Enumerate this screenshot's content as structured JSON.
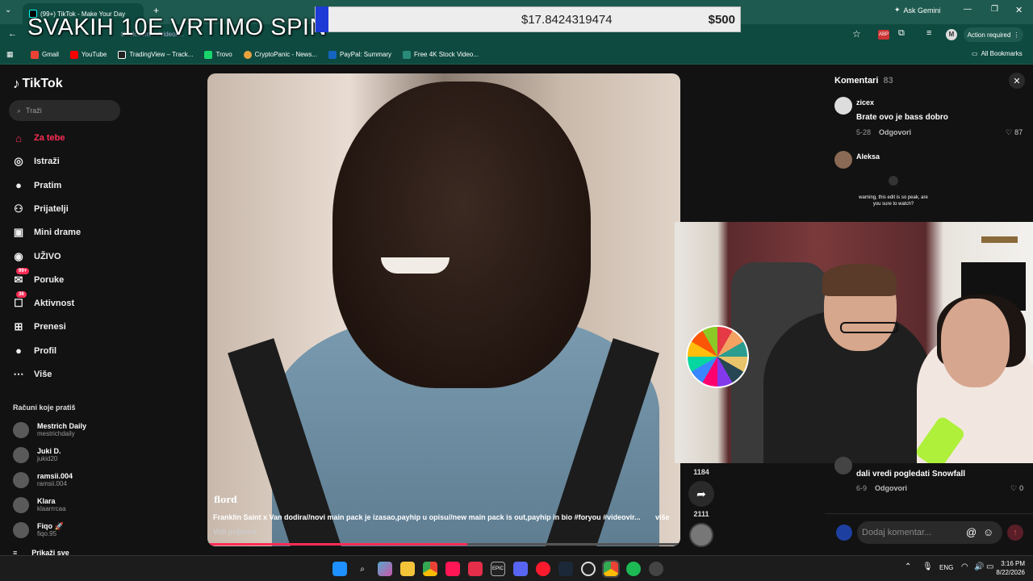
{
  "browser": {
    "tab_title": "(99+) TikTok - Make Your Day",
    "address_partial": "tiktok.com/…/video/…",
    "ask_gemini": "Ask Gemini",
    "action_required": "Action required",
    "bookmarks": [
      "Gmail",
      "YouTube",
      "TradingView – Track...",
      "Trovo",
      "CryptoPanic - News...",
      "PayPal: Summary",
      "Free 4K Stock Video..."
    ],
    "all_bookmarks": "All Bookmarks"
  },
  "overlay": {
    "title": "SVAKIH 10E VRTIMO SPIN",
    "donation_amount": "$17.8424319474",
    "donation_goal": "$500"
  },
  "tiktok": {
    "logo": "TikTok",
    "search_placeholder": "Traži",
    "nav": [
      {
        "label": "Za tebe",
        "icon": "home-icon",
        "active": true
      },
      {
        "label": "Istraži",
        "icon": "compass-icon"
      },
      {
        "label": "Pratim",
        "icon": "following-icon"
      },
      {
        "label": "Prijatelji",
        "icon": "friends-icon"
      },
      {
        "label": "Mini drame",
        "icon": "drama-icon"
      },
      {
        "label": "UŽIVO",
        "icon": "live-icon"
      },
      {
        "label": "Poruke",
        "icon": "message-icon",
        "badge": "99+"
      },
      {
        "label": "Aktivnost",
        "icon": "activity-icon",
        "badge": "36"
      },
      {
        "label": "Prenesi",
        "icon": "upload-icon"
      },
      {
        "label": "Profil",
        "icon": "profile-icon"
      },
      {
        "label": "Više",
        "icon": "more-icon"
      }
    ],
    "following_title": "Računi koje pratiš",
    "following": [
      {
        "name": "Mestrich Daily",
        "handle": "mestrichdaily"
      },
      {
        "name": "Juki D.",
        "handle": "jukid20"
      },
      {
        "name": "ramsii.004",
        "handle": "ramsii.004"
      },
      {
        "name": "Klara",
        "handle": "klaarrrcaa"
      },
      {
        "name": "Fiqo 🚀",
        "handle": "fiqo.95"
      }
    ],
    "show_all": "Prikaži sve"
  },
  "video": {
    "author": "flord",
    "description": "Franklin Saint x Van dodira//novi main pack je izasao,payhip u opisu//new main pack is out,payhip in bio #foryou #videovir...",
    "more": "više",
    "translation": "Vidi prijevod",
    "progress": 0.55,
    "comment_count": "1184",
    "share_count": "2111"
  },
  "comments": {
    "title": "Komentari",
    "count": "83",
    "items": [
      {
        "user": "zicex",
        "text": "Brate ovo je bass dobro",
        "date": "5-28",
        "reply": "Odgovori",
        "likes": "87"
      },
      {
        "user": "Aleksa",
        "text": "warning, this edit is so peak, are you sure to watch?"
      },
      {
        "user": "",
        "text": "dali vredi pogledati Snowfall",
        "date": "6-9",
        "reply": "Odgovori",
        "likes": "0"
      }
    ],
    "input_placeholder": "Dodaj komentar..."
  },
  "taskbar": {
    "lang": "ENG",
    "time": "3:16 PM",
    "date": "8/22/2026"
  }
}
